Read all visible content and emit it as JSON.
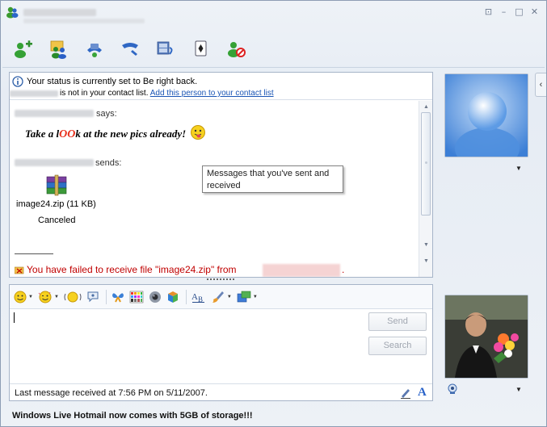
{
  "window": {
    "title_redacted": true,
    "controls": [
      "restore",
      "minimize",
      "maximize",
      "close"
    ]
  },
  "toolbar": {
    "buttons": [
      {
        "name": "invite-contact",
        "icon": "add-person-icon"
      },
      {
        "name": "share-files",
        "icon": "share-folder-icon"
      },
      {
        "name": "video-call",
        "icon": "video-phone-icon"
      },
      {
        "name": "call",
        "icon": "phone-handset-icon"
      },
      {
        "name": "activities",
        "icon": "film-icon"
      },
      {
        "name": "games",
        "icon": "playing-card-icon"
      },
      {
        "name": "block",
        "icon": "block-person-icon"
      }
    ]
  },
  "info_bar": {
    "status": "Your status is currently set to Be right back.",
    "not_in_list": "is not in your contact list.",
    "add_link": "Add this person to your contact list"
  },
  "conversation": {
    "says_label": "says:",
    "message_parts": [
      "Take a l",
      "OO",
      "k at the new pics already!"
    ],
    "sends_label": "sends:",
    "file_name": "image24.zip (11 KB)",
    "file_state": "Canceled",
    "fail_message": "You have failed to receive file \"image24.zip\" from",
    "fail_end": "."
  },
  "tooltip": {
    "text": "Messages that you've sent and received"
  },
  "compose": {
    "send_label": "Send",
    "search_label": "Search",
    "last_message": "Last message received at 7:56 PM on 5/11/2007.",
    "font_button": "A"
  },
  "footer": {
    "ad_text": "Windows Live Hotmail now comes with 5GB of storage!!!"
  },
  "colors": {
    "accent_link": "#1a55b5",
    "error_red": "#c00000",
    "window_bg": "#e9eef5"
  }
}
